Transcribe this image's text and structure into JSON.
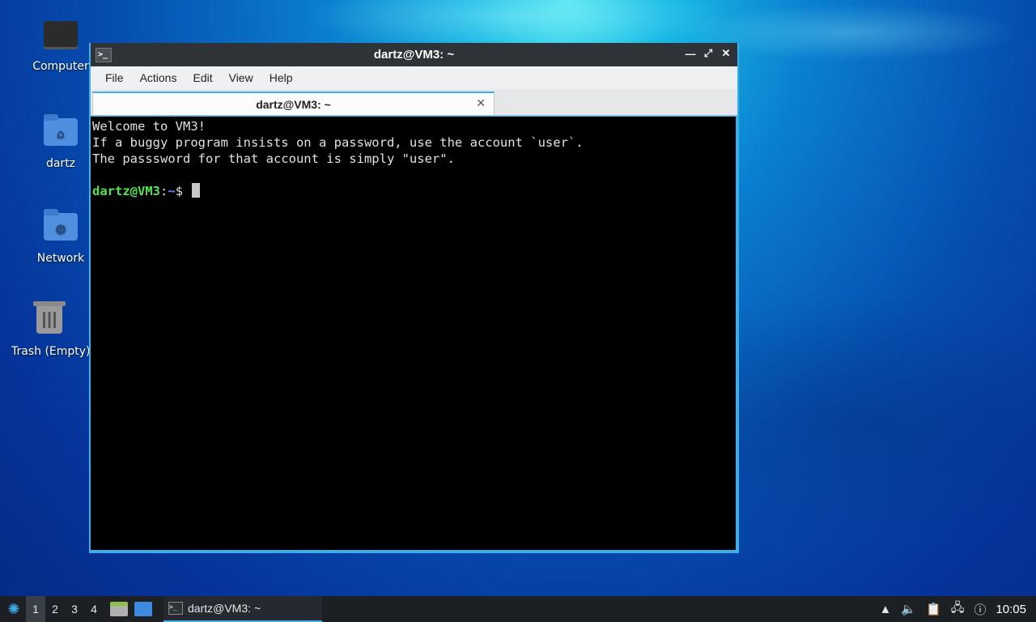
{
  "desktop": {
    "icons": [
      {
        "label": "Computer"
      },
      {
        "label": "dartz"
      },
      {
        "label": "Network"
      },
      {
        "label": "Trash (Empty)"
      }
    ]
  },
  "window": {
    "title": "dartz@VM3: ~",
    "menu": [
      "File",
      "Actions",
      "Edit",
      "View",
      "Help"
    ],
    "tab_label": "dartz@VM3: ~",
    "terminal": {
      "lines": [
        "Welcome to VM3!",
        "If a buggy program insists on a password, use the account `user`.",
        "The passsword for that account is simply \"user\".",
        ""
      ],
      "prompt_user": "dartz@VM3",
      "prompt_sep": ":",
      "prompt_path": "~",
      "prompt_symbol": "$ "
    }
  },
  "taskbar": {
    "workspaces": [
      "1",
      "2",
      "3",
      "4"
    ],
    "active_workspace": "1",
    "task_label": "dartz@VM3: ~",
    "clock": "10:05"
  },
  "colors": {
    "accent": "#3daee9",
    "prompt_user": "#54e154",
    "prompt_path": "#5b8cff"
  }
}
